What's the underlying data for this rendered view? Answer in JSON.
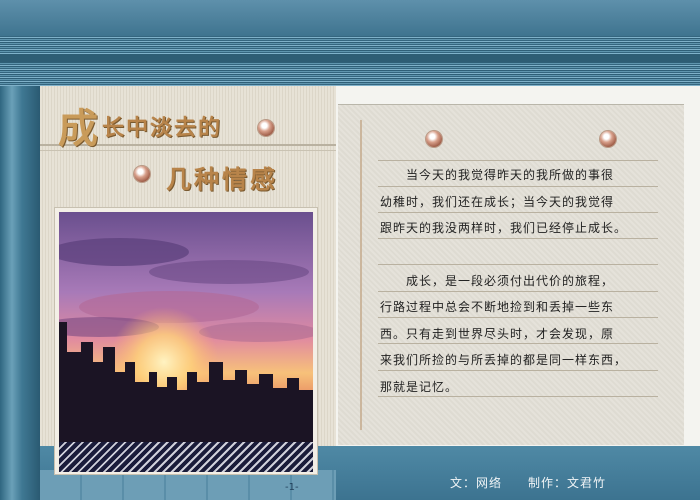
{
  "title": {
    "first_char": "成",
    "line1_rest": "长中淡去的",
    "line2": "几种情感"
  },
  "paragraphs": [
    [
      "　　当今天的我觉得昨天的我所做的事很",
      "幼稚时，我们还在成长；当今天的我觉得",
      "跟昨天的我没两样时，我们已经停止成长。"
    ],
    [
      "　　成长，是一段必须付出代价的旅程，",
      "行路过程中总会不断地捡到和丢掉一些东",
      "西。只有走到世界尽头时，才会发现，原",
      "来我们所捡的与所丢掉的都是同一样东西，",
      "那就是记忆。"
    ]
  ],
  "footer": {
    "page_number": "-1-",
    "credits": "文：网络　　制作：文君竹"
  },
  "photo": {
    "subject": "sunset city skyline"
  }
}
